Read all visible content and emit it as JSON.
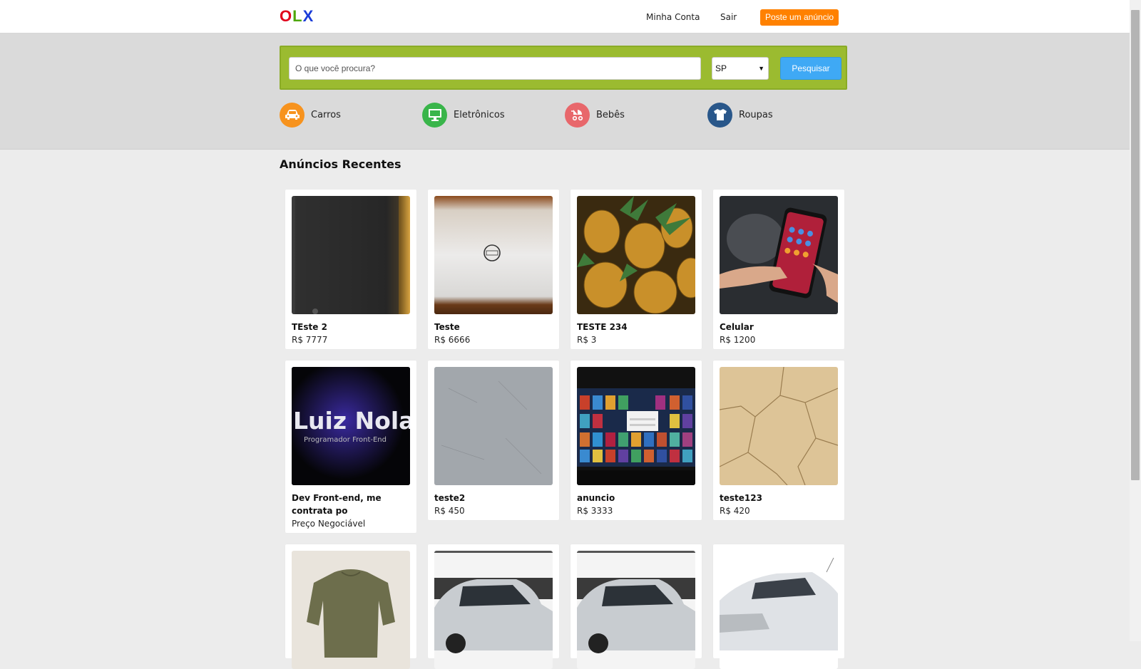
{
  "header": {
    "logo": {
      "o": "O",
      "l": "L",
      "x": "X"
    },
    "links": {
      "account": "Minha Conta",
      "logout": "Sair"
    },
    "post_button": "Poste um anúncio"
  },
  "search": {
    "placeholder": "O que você procura?",
    "state": "SP",
    "button": "Pesquisar"
  },
  "categories": [
    {
      "label": "Carros",
      "icon": "car-icon",
      "color": "#f7931e"
    },
    {
      "label": "Eletrônicos",
      "icon": "monitor-icon",
      "color": "#39b54a"
    },
    {
      "label": "Bebês",
      "icon": "baby-stroller-icon",
      "color": "#e8676b"
    },
    {
      "label": "Roupas",
      "icon": "shirt-icon",
      "color": "#29578a"
    }
  ],
  "recent": {
    "title": "Anúncios Recentes",
    "ads": [
      {
        "title": "TEste 2",
        "price": "R$ 7777"
      },
      {
        "title": "Teste",
        "price": "R$ 6666"
      },
      {
        "title": "TESTE 234",
        "price": "R$ 3"
      },
      {
        "title": "Celular",
        "price": "R$ 1200"
      },
      {
        "title": "Dev Front-end, me contrata po",
        "price": "Preço Negociável",
        "image_text": "Luiz Nola",
        "image_subtext": "Programador Front-End"
      },
      {
        "title": "teste2",
        "price": "R$ 450"
      },
      {
        "title": "anuncio",
        "price": "R$ 3333"
      },
      {
        "title": "teste123",
        "price": "R$ 420"
      },
      {
        "title": "",
        "price": ""
      },
      {
        "title": "",
        "price": ""
      },
      {
        "title": "",
        "price": ""
      },
      {
        "title": "",
        "price": ""
      }
    ]
  },
  "colors": {
    "logo_o": "#e0001b",
    "logo_l": "#4ea70a",
    "logo_x": "#1a3cd8",
    "post_button": "#ff8100",
    "search_box": "#9bbb30",
    "search_button": "#3fa9f5"
  }
}
